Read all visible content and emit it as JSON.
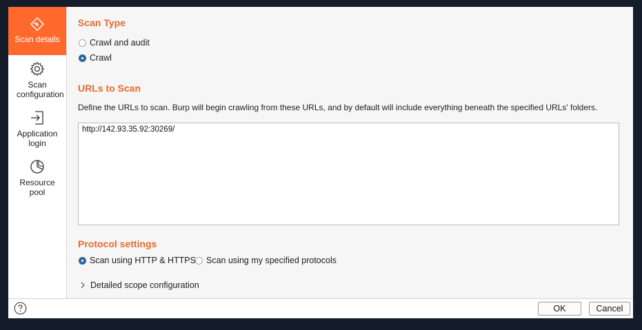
{
  "sidebar": {
    "items": [
      {
        "label": "Scan details",
        "icon": "scan-target-icon",
        "active": true
      },
      {
        "label": "Scan configuration",
        "icon": "gear-icon"
      },
      {
        "label": "Application login",
        "icon": "login-icon"
      },
      {
        "label": "Resource pool",
        "icon": "pie-chart-icon"
      }
    ]
  },
  "scan_type": {
    "title": "Scan Type",
    "options": [
      {
        "label": "Crawl and audit",
        "selected": false
      },
      {
        "label": "Crawl",
        "selected": true
      }
    ]
  },
  "urls": {
    "title": "URLs to Scan",
    "description": "Define the URLs to scan. Burp will begin crawling from these URLs, and by default will include everything beneath the specified URLs' folders.",
    "value": "http://142.93.35.92:30269/"
  },
  "protocol": {
    "title": "Protocol settings",
    "options": [
      {
        "label": "Scan using HTTP & HTTPS",
        "selected": true
      },
      {
        "label": "Scan using my specified protocols",
        "selected": false
      }
    ]
  },
  "scope": {
    "label": "Detailed scope configuration",
    "expanded": false
  },
  "footer": {
    "ok_label": "OK",
    "cancel_label": "Cancel",
    "help_icon": "help-icon"
  },
  "colors": {
    "accent": "#ff6a2c",
    "section_title": "#e8692d",
    "radio_selected": "#2f6aa5"
  }
}
